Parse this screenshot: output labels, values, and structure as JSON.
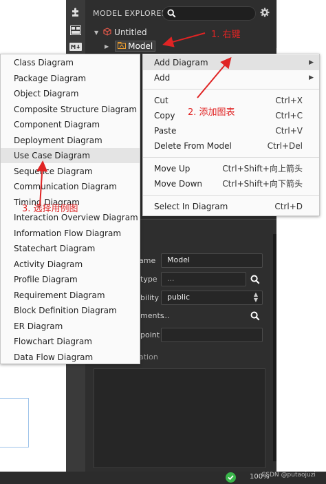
{
  "explorer": {
    "title": "MODEL EXPLORER",
    "tree": {
      "project": "Untitled",
      "model": "Model"
    }
  },
  "properties": {
    "name_label": "ame",
    "name_value": "Model",
    "type_label": "type",
    "type_value": "...",
    "visibility_label": "bility",
    "visibility_value": "public",
    "elements_label": "ments",
    "elements_value": "...",
    "viewpoint_label": "point",
    "viewpoint_value": "",
    "documentation_label": "ation"
  },
  "context_menu": {
    "items": [
      {
        "label": "Add Diagram",
        "shortcut": "",
        "submenu": true
      },
      {
        "label": "Add",
        "shortcut": "",
        "submenu": true
      },
      {
        "label": "Cut",
        "shortcut": "Ctrl+X"
      },
      {
        "label": "Copy",
        "shortcut": "Ctrl+C"
      },
      {
        "label": "Paste",
        "shortcut": "Ctrl+V"
      },
      {
        "label": "Delete From Model",
        "shortcut": "Ctrl+Del"
      },
      {
        "label": "Move Up",
        "shortcut": "Ctrl+Shift+向上箭头"
      },
      {
        "label": "Move Down",
        "shortcut": "Ctrl+Shift+向下箭头"
      },
      {
        "label": "Select In Diagram",
        "shortcut": "Ctrl+D"
      }
    ]
  },
  "diagram_submenu": {
    "items": [
      "Class Diagram",
      "Package Diagram",
      "Object Diagram",
      "Composite Structure Diagram",
      "Component Diagram",
      "Deployment Diagram",
      "Use Case Diagram",
      "Sequence Diagram",
      "Communication Diagram",
      "Timing Diagram",
      "Interaction Overview Diagram",
      "Information Flow Diagram",
      "Statechart Diagram",
      "Activity Diagram",
      "Profile Diagram",
      "Requirement Diagram",
      "Block Definition Diagram",
      "ER Diagram",
      "Flowchart Diagram",
      "Data Flow Diagram"
    ]
  },
  "annotations": {
    "step1": "1. 右键",
    "step2": "2. 添加图表",
    "step3": "3. 选择用例图",
    "color": "#e02424"
  },
  "statusbar": {
    "zoom": "100%",
    "watermark": "CSDN @putaojuzi"
  },
  "icons": [
    "puzzle-icon",
    "layout-icon",
    "markdown-icon",
    "search-icon",
    "gear-icon",
    "chevron-down-icon",
    "chevron-right-icon",
    "cube-icon",
    "model-icon",
    "check-icon",
    "up-down-icon"
  ]
}
